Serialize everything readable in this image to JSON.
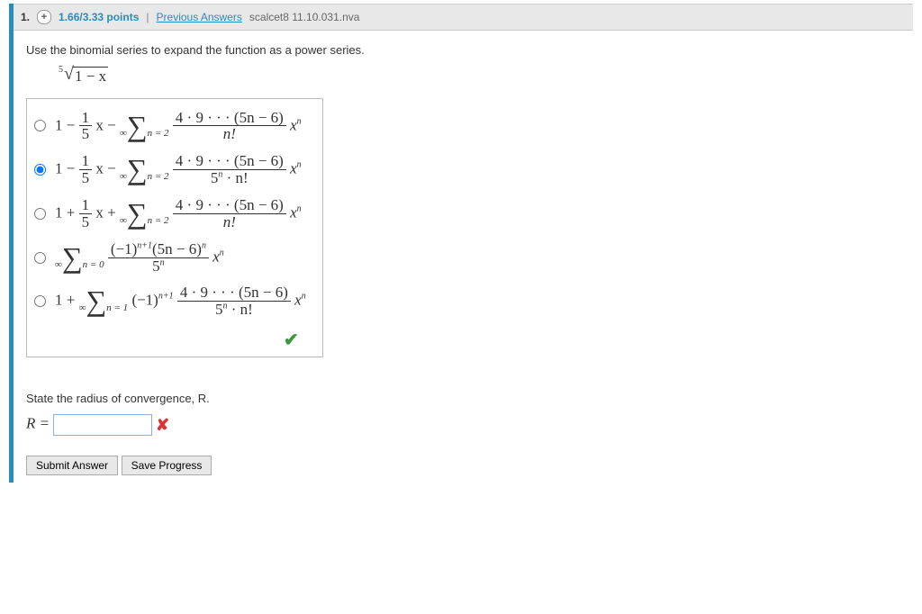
{
  "header": {
    "qnum": "1.",
    "points": "1.66/3.33 points",
    "prev": "Previous Answers",
    "assign": "scalcet8 11.10.031.nva"
  },
  "prompt": "Use the binomial series to expand the function as a power series.",
  "root_index": "5",
  "root_body": "1 − x",
  "choices": {
    "c1": {
      "lead": "1 −",
      "pref_num": "1",
      "pref_den": "5",
      "mid": "x −",
      "n_top": "4 · 9 · · · (5n − 6)",
      "n_bot": "n!",
      "tail": "x",
      "tail_sup": "n"
    },
    "c2": {
      "lead": "1 −",
      "pref_num": "1",
      "pref_den": "5",
      "mid": "x −",
      "n_top": "4 · 9 · · · (5n − 6)",
      "n_bot": "5",
      "n_bot_sup": "n",
      "n_bot2": " · n!",
      "tail": "x",
      "tail_sup": "n"
    },
    "c3": {
      "lead": "1 +",
      "pref_num": "1",
      "pref_den": "5",
      "mid": "x +",
      "n_top": "4 · 9 · · · (5n − 6)",
      "n_bot": "n!",
      "tail": "x",
      "tail_sup": "n"
    },
    "c4": {
      "n_top_a": "(−1)",
      "n_top_sup": "n+1",
      "n_top_b": "(5n − 6)",
      "n_top_b_sup": "n",
      "n_bot": "5",
      "n_bot_sup": "n",
      "tail": "x",
      "tail_sup": "n"
    },
    "c5": {
      "lead": "1 +",
      "factor_a": "(−1)",
      "factor_sup": "n+1",
      "n_top": "4 · 9 · · · (5n − 6)",
      "n_bot": "5",
      "n_bot_sup": "n",
      "n_bot2": " · n!",
      "tail": "x",
      "tail_sup": "n"
    },
    "sigma2": {
      "top": "∞",
      "bot": "n = 2"
    },
    "sigma0": {
      "top": "∞",
      "bot": "n = 0"
    },
    "sigma1": {
      "top": "∞",
      "bot": "n = 1"
    }
  },
  "part2_prompt": "State the radius of convergence, R.",
  "r_label": "R = ",
  "r_value": "",
  "buttons": {
    "submit": "Submit Answer",
    "save": "Save Progress"
  }
}
